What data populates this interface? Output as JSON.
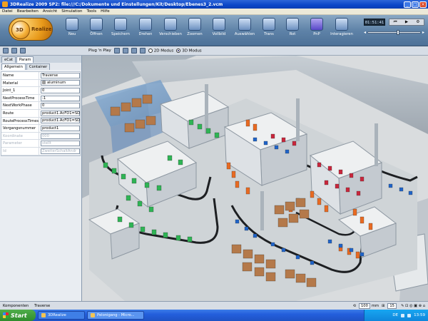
{
  "window": {
    "title": "3DRealize 2009 SP2: file:///C:/Dokumente und Einstellungen/Kit/Desktop/Ebenes3_2.vcm"
  },
  "menu": [
    "Datei",
    "Bearbeiten",
    "Ansicht",
    "Simulation",
    "Tools",
    "Hilfe"
  ],
  "ribbon": {
    "logo_text": "3DRealize",
    "buttons": [
      {
        "label": "Neu",
        "icon": "new-file-icon"
      },
      {
        "label": "Öffnen",
        "icon": "open-folder-icon"
      },
      {
        "label": "Speichern",
        "icon": "save-icon"
      },
      {
        "label": "Drehen",
        "icon": "rotate-icon"
      },
      {
        "label": "Verschieben",
        "icon": "move-icon"
      },
      {
        "label": "Zoomen",
        "icon": "zoom-icon"
      },
      {
        "label": "Vollbild",
        "icon": "fullscreen-icon"
      },
      {
        "label": "Auswählen",
        "icon": "select-arrow-icon"
      },
      {
        "label": "Trans",
        "icon": "transform-icon"
      },
      {
        "label": "Rot",
        "icon": "rotation-gizmo-icon"
      },
      {
        "label": "PnP",
        "icon": "plug-and-play-icon"
      },
      {
        "label": "Interagieren",
        "icon": "interact-hand-icon"
      }
    ],
    "clock": "01:51:41",
    "speed_fraction": 0.55
  },
  "subbar": {
    "plugnplay": "Plug 'n Play",
    "mode_2d": "2D Modus",
    "mode_3d": "3D Modus",
    "selected_mode": "3D Modus"
  },
  "panel": {
    "tabs": [
      "eCat",
      "Param"
    ],
    "active_tab": "Param",
    "subtabs": [
      "Allgemein",
      "Container"
    ],
    "active_subtab": "Allgemein",
    "rows": [
      {
        "key": "Name",
        "value": "Traverse",
        "dim": false
      },
      {
        "key": "Material",
        "value": "aluminum",
        "dim": false
      },
      {
        "key": "Joint_1",
        "value": "0",
        "dim": false
      },
      {
        "key": "NextProcessTime",
        "value": "-1",
        "dim": false
      },
      {
        "key": "NextWorkPhase",
        "value": "0",
        "dim": false
      },
      {
        "key": "Route",
        "value": "product1.AcFD1=SD",
        "dim": false
      },
      {
        "key": "RouteProcessTimes",
        "value": "product1.AcFD1=SD",
        "dim": false
      },
      {
        "key": "Vorgangsnummer",
        "value": "product1",
        "dim": false
      },
      {
        "key": "Koordinate",
        "value": "000",
        "dim": true
      },
      {
        "key": "Parameter",
        "value": "stellt",
        "dim": true
      },
      {
        "key": "Id",
        "value": "ZweiterSchaltAndr",
        "dim": true
      }
    ]
  },
  "status": {
    "component_label": "Komponenten",
    "component_value": "Traverse",
    "grid_value": "100",
    "grid_unit": "mm",
    "snap_value": "15"
  },
  "taskbar": {
    "start": "Start",
    "tasks": [
      "3DRealize",
      "Pelonigang - Micro..."
    ],
    "lang": "DE",
    "time": "13:59"
  },
  "colors": {
    "titlebar": "#0a46c8",
    "ribbon": "#5f83a8",
    "floor": "#d5d8da",
    "conveyor": "#1d1f22",
    "box": "#b4794a",
    "robot_orange": "#e86a22",
    "robot_green": "#2fb455",
    "robot_red": "#c8263c",
    "blue_part": "#1f63c8"
  }
}
